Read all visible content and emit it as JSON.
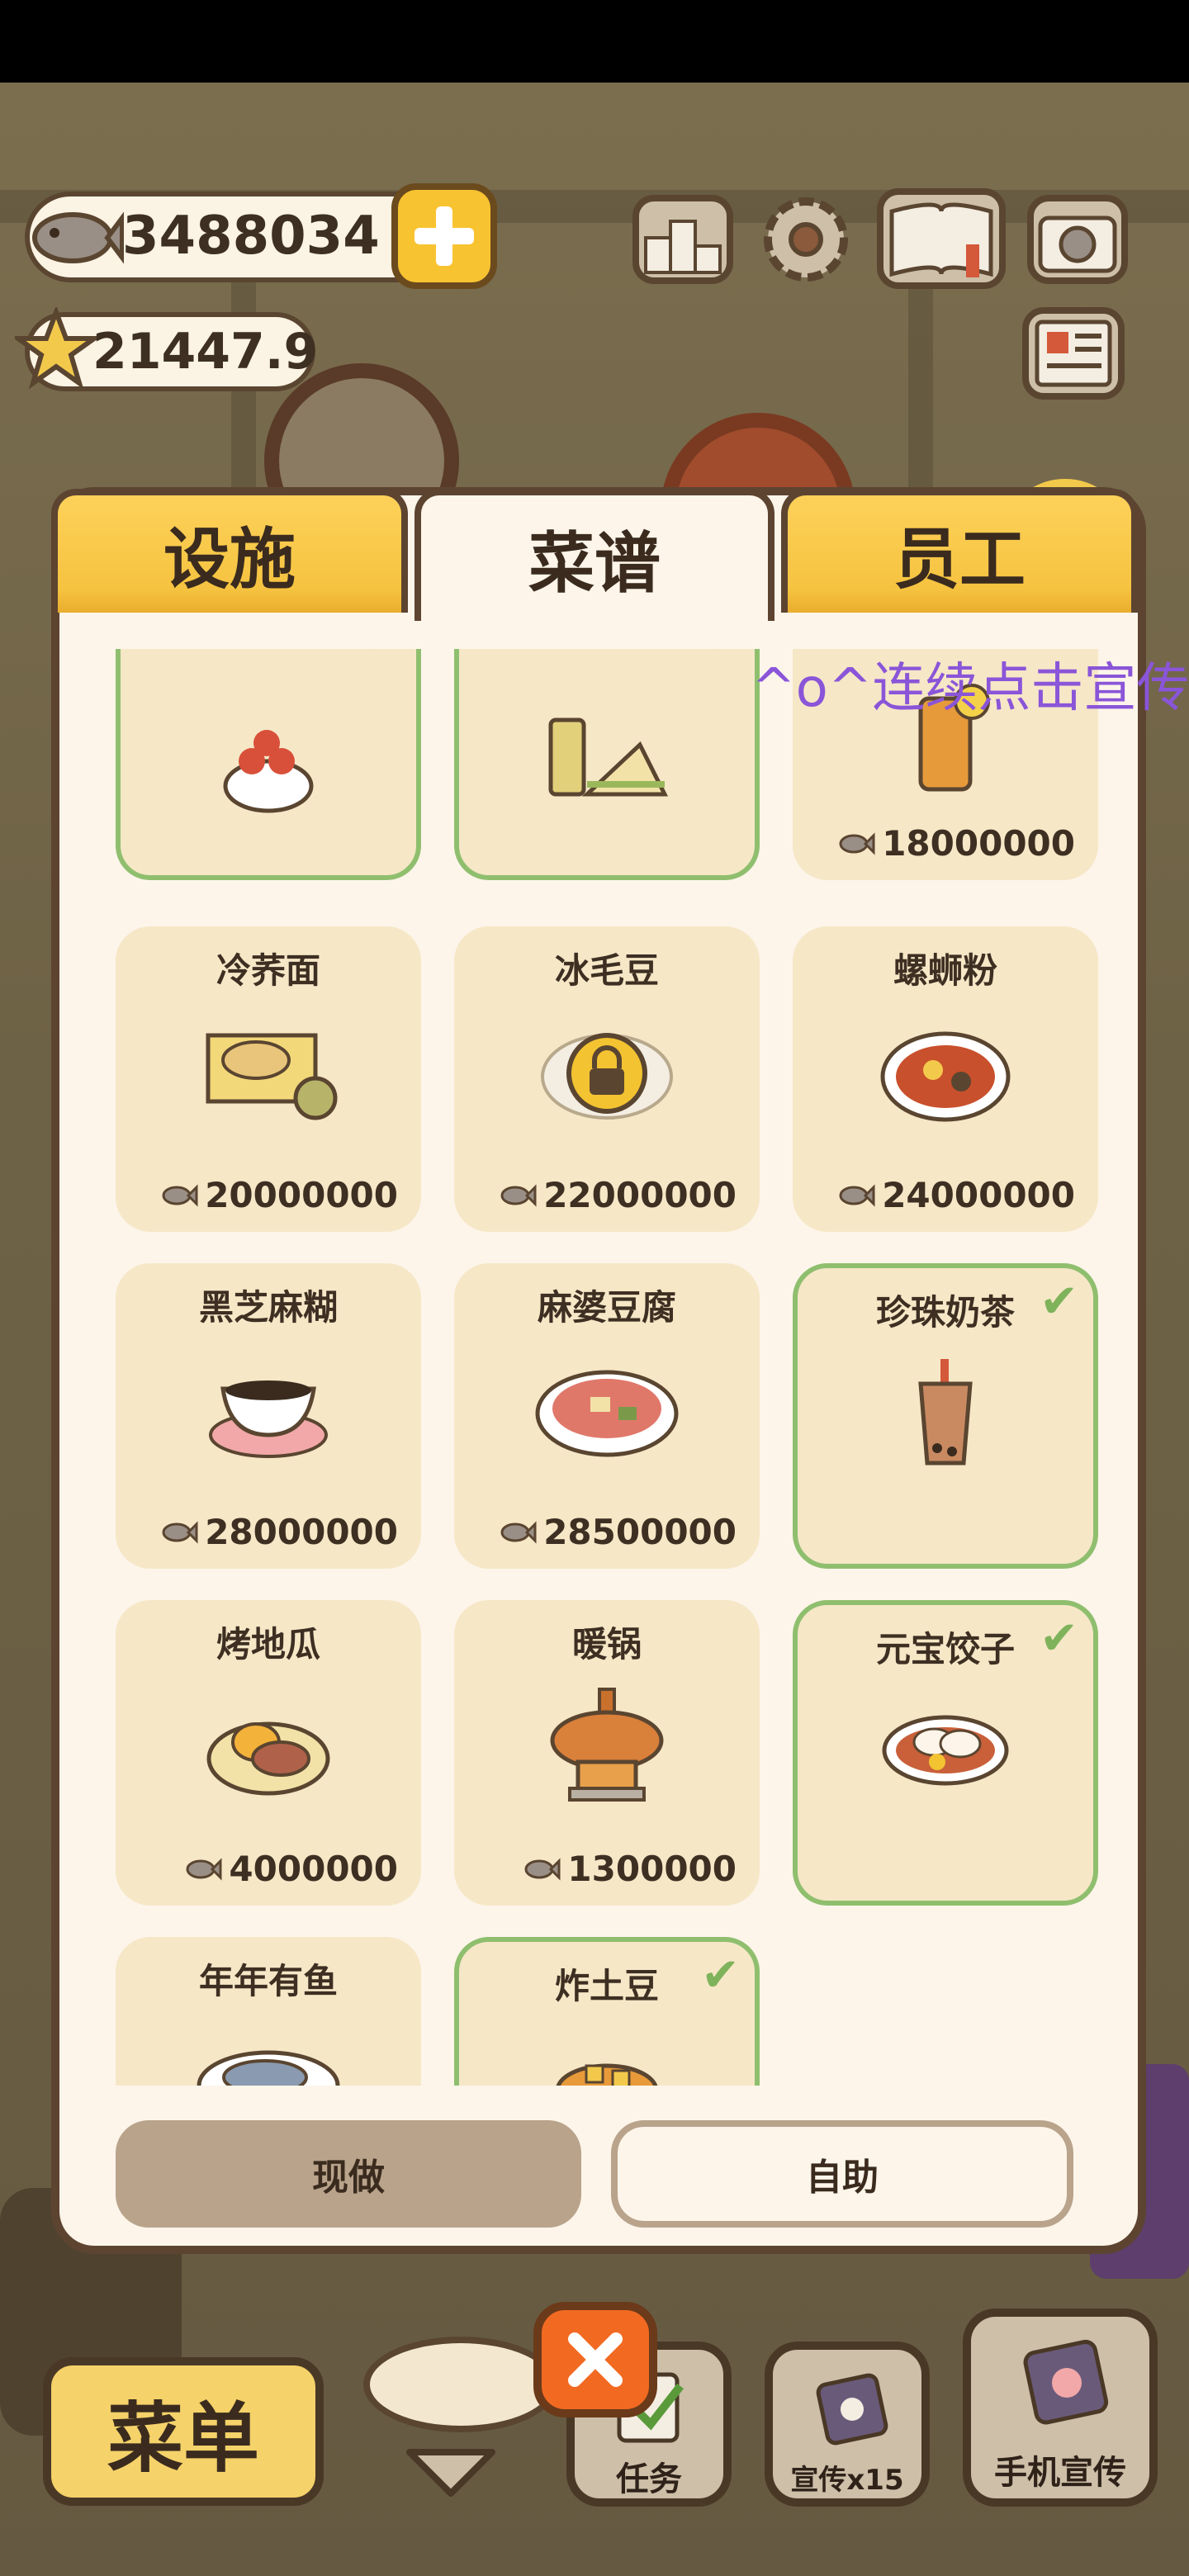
{
  "hud": {
    "fish_amount": "3488034",
    "star_amount": "21447.9"
  },
  "tabs": [
    {
      "label": "设施"
    },
    {
      "label": "菜谱"
    },
    {
      "label": "员工"
    }
  ],
  "overlay_text": "^o^连续点击宣传招",
  "recipes": [
    {
      "name": "",
      "price": "",
      "owned": true,
      "food_icon": "strawberry-shaved-ice-icon"
    },
    {
      "name": "",
      "price": "",
      "owned": true,
      "food_icon": "sandwich-icon"
    },
    {
      "name": "",
      "price": "18000000",
      "owned": false,
      "food_icon": "lemon-tea-icon"
    },
    {
      "name": "冷荞面",
      "price": "20000000",
      "owned": false,
      "food_icon": "cold-soba-icon"
    },
    {
      "name": "冰毛豆",
      "price": "22000000",
      "owned": false,
      "locked": true,
      "food_icon": "lock-icon"
    },
    {
      "name": "螺蛳粉",
      "price": "24000000",
      "owned": false,
      "food_icon": "snail-noodle-icon"
    },
    {
      "name": "黑芝麻糊",
      "price": "28000000",
      "owned": false,
      "food_icon": "black-sesame-paste-icon"
    },
    {
      "name": "麻婆豆腐",
      "price": "28500000",
      "owned": false,
      "food_icon": "mapo-tofu-icon"
    },
    {
      "name": "珍珠奶茶",
      "price": "",
      "owned": true,
      "food_icon": "bubble-tea-icon"
    },
    {
      "name": "烤地瓜",
      "price": "4000000",
      "owned": false,
      "food_icon": "roast-sweet-potato-icon"
    },
    {
      "name": "暖锅",
      "price": "1300000",
      "owned": false,
      "food_icon": "hot-pot-icon"
    },
    {
      "name": "元宝饺子",
      "price": "",
      "owned": true,
      "food_icon": "dumplings-icon"
    },
    {
      "name": "年年有鱼",
      "price": "",
      "owned": false,
      "food_icon": "fish-dish-icon"
    },
    {
      "name": "炸土豆",
      "price": "",
      "owned": true,
      "food_icon": "fried-potato-icon"
    }
  ],
  "buttons": {
    "made_to_order": "现做",
    "self_service": "自助"
  },
  "bottom_bar": {
    "menu_label": "菜单",
    "tasks_label": "任务",
    "promo_label": "宣传x15",
    "phone_promo_label": "手机宣传"
  },
  "colors": {
    "panel_bg": "#fdf5ea",
    "card_bg": "#f6e7c7",
    "owned_border": "#8fbf6e",
    "tab_yellow": "#f6c340",
    "overlay_purple": "#8a55d8"
  }
}
